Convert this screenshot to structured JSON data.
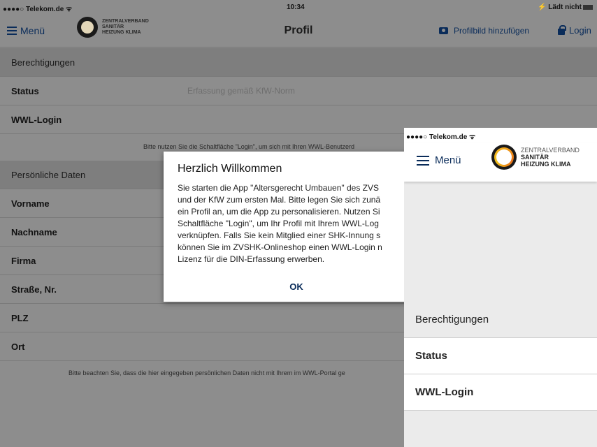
{
  "tablet": {
    "status": {
      "carrier": "●●●●○ Telekom.de ᯤ",
      "time": "10:34",
      "charging": "⚡ Lädt nicht"
    },
    "nav": {
      "menu_label": "Menü",
      "logo_line1": "ZENTRALVERBAND",
      "logo_line2": "SANITÄR",
      "logo_line3": "HEIZUNG KLIMA",
      "title": "Profil",
      "add_picture_label": "Profilbild hinzufügen",
      "login_label": "Login"
    },
    "rows": {
      "berechtigungen": "Berechtigungen",
      "status_label": "Status",
      "status_value": "Erfassung gemäß KfW-Norm",
      "wwl_login": "WWL-Login",
      "hint1": "Bitte nutzen Sie die Schaltfläche \"Login\", um sich mit Ihren WWL-Benutzerd",
      "persoenliche_daten": "Persönliche Daten",
      "vorname": "Vorname",
      "nachname": "Nachname",
      "firma": "Firma",
      "strasse": "Straße, Nr.",
      "plz": "PLZ",
      "ort": "Ort",
      "hint2": "Bitte beachten Sie, dass die hier eingegeben persönlichen Daten nicht mit Ihrem im WWL-Portal ge"
    }
  },
  "dialog": {
    "title": "Herzlich Willkommen",
    "lines": [
      "Sie starten die App \"Altersgerecht Umbauen\" des ZVS",
      "und der KfW zum ersten Mal. Bitte legen Sie sich zunä",
      "ein Profil an, um die App zu personalisieren. Nutzen Si",
      "Schaltfläche \"Login\", um Ihr Profil mit Ihrem WWL-Log",
      "verknüpfen. Falls Sie kein Mitglied einer SHK-Innung s",
      "können Sie im ZVSHK-Onlineshop einen WWL-Login n",
      "Lizenz für die DIN-Erfassung erwerben."
    ],
    "ok_label": "OK"
  },
  "phone": {
    "status": {
      "carrier": "●●●●○ Telekom.de ᯤ"
    },
    "nav": {
      "menu_label": "Menü",
      "logo_line1": "ZENTRALVERBAND",
      "logo_line2": "SANITÄR",
      "logo_line3": "HEIZUNG KLIMA"
    },
    "rows": {
      "berechtigungen": "Berechtigungen",
      "status_label": "Status",
      "wwl_login": "WWL-Login"
    }
  },
  "colors": {
    "accent": "#0a2c5a",
    "overlay_gray": "#8d8d8d",
    "logo_orange": "#f2a81d"
  }
}
